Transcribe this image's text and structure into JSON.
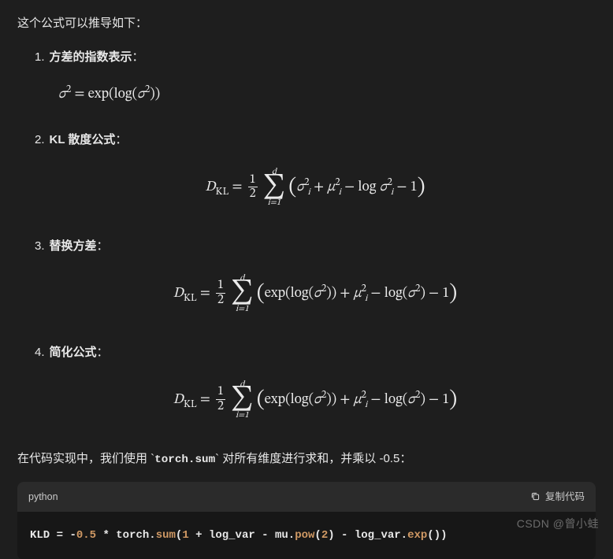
{
  "intro": "这个公式可以推导如下：",
  "items": [
    {
      "title": "方差的指数表示",
      "colon": "："
    },
    {
      "title": "KL 散度公式",
      "colon": "："
    },
    {
      "title": "替换方差",
      "colon": "："
    },
    {
      "title": "简化公式",
      "colon": "："
    }
  ],
  "formulas": {
    "f1": {
      "sigma": "σ",
      "sq": "2",
      "eq": " = ",
      "exp": "exp",
      "lp": "(",
      "log": "log",
      "lp2": "(",
      "sigma2": "σ",
      "sq2": "2",
      "rp2": ")",
      "rp": ")"
    },
    "f2": {
      "D": "D",
      "KL": "KL",
      "eq": " = ",
      "half_num": "1",
      "half_den": "2",
      "sum_top": "d",
      "sum_sym": "∑",
      "sum_bot": "i=1",
      "lp": "(",
      "sigma": "σ",
      "i": "i",
      "sq": "2",
      "plus": " + ",
      "mu": "μ",
      "minus": " − ",
      "log": "log",
      "sp": " ",
      "minus2": " − ",
      "one": "1",
      "rp": ")"
    },
    "f3": {
      "D": "D",
      "KL": "KL",
      "eq": " = ",
      "half_num": "1",
      "half_den": "2",
      "sum_top": "d",
      "sum_sym": "∑",
      "sum_bot": "i=1",
      "lp": "(",
      "exp": "exp",
      "lp2": "(",
      "log": "log",
      "lp3": "(",
      "sigma": "σ",
      "sq": "2",
      "rp3": ")",
      "rp2": ")",
      "plus": " + ",
      "mu": "μ",
      "i": "i",
      "minus": " − ",
      "log2": "log",
      "lp4": "(",
      "sigma2": "σ",
      "sq2": "2",
      "rp4": ")",
      "minus2": " − ",
      "one": "1",
      "rp": ")"
    }
  },
  "para": {
    "pre": "在代码实现中，我们使用 `",
    "code": "torch.sum",
    "post": "` 对所有维度进行求和，并乘以 -0.5："
  },
  "code": {
    "lang": "python",
    "copy": "复制代码",
    "tokens": {
      "kld": "KLD",
      "sp1": " ",
      "eq": "=",
      "sp2": " ",
      "neg": "-",
      "n05": "0.5",
      "sp3": " ",
      "star": "*",
      "sp4": " ",
      "torch": "torch",
      "dot1": ".",
      "sum": "sum",
      "lp": "(",
      "one": "1",
      "sp5": " ",
      "plus": "+",
      "sp6": " ",
      "logvar": "log_var",
      "sp7": " ",
      "minus1": "-",
      "sp8": " ",
      "mu": "mu",
      "dot2": ".",
      "pow": "pow",
      "lp2": "(",
      "two": "2",
      "rp2": ")",
      "sp9": " ",
      "minus2": "-",
      "sp10": " ",
      "logvar2": "log_var",
      "dot3": ".",
      "expf": "exp",
      "lp3": "(",
      "rp3": ")",
      "rp": ")"
    }
  },
  "watermark": "CSDN @曾小蛙"
}
